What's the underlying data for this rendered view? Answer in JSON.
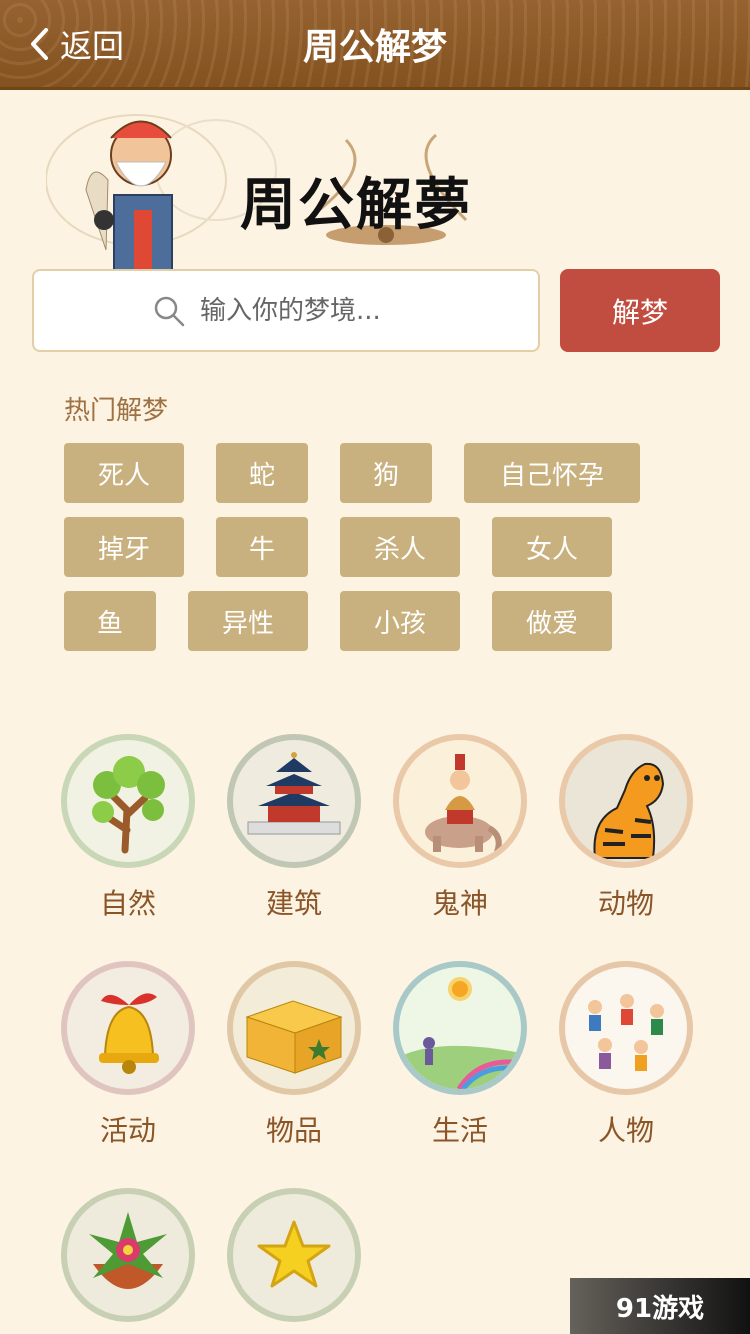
{
  "nav": {
    "back_label": "返回",
    "title": "周公解梦"
  },
  "banner": {
    "logo_text": "周公解夢"
  },
  "search": {
    "placeholder": "输入你的梦境...",
    "button_label": "解梦"
  },
  "hot": {
    "title": "热门解梦",
    "tags": [
      "死人",
      "蛇",
      "狗",
      "自己怀孕",
      "掉牙",
      "牛",
      "杀人",
      "女人",
      "鱼",
      "异性",
      "小孩",
      "做爱"
    ]
  },
  "categories": [
    {
      "label": "自然",
      "icon": "tree-icon"
    },
    {
      "label": "建筑",
      "icon": "temple-icon"
    },
    {
      "label": "鬼神",
      "icon": "deity-elephant-icon"
    },
    {
      "label": "动物",
      "icon": "tiger-icon"
    },
    {
      "label": "活动",
      "icon": "bell-icon"
    },
    {
      "label": "物品",
      "icon": "package-icon"
    },
    {
      "label": "生活",
      "icon": "sunny-landscape-icon"
    },
    {
      "label": "人物",
      "icon": "people-icon"
    },
    {
      "label": "",
      "icon": "flower-pot-icon"
    },
    {
      "label": "",
      "icon": "star-icon"
    }
  ],
  "watermark": "91游戏",
  "colors": {
    "nav": "#8e5a2a",
    "accent_button": "#c04d3f",
    "tag": "#c9b07f",
    "background": "#fdf3e3"
  }
}
